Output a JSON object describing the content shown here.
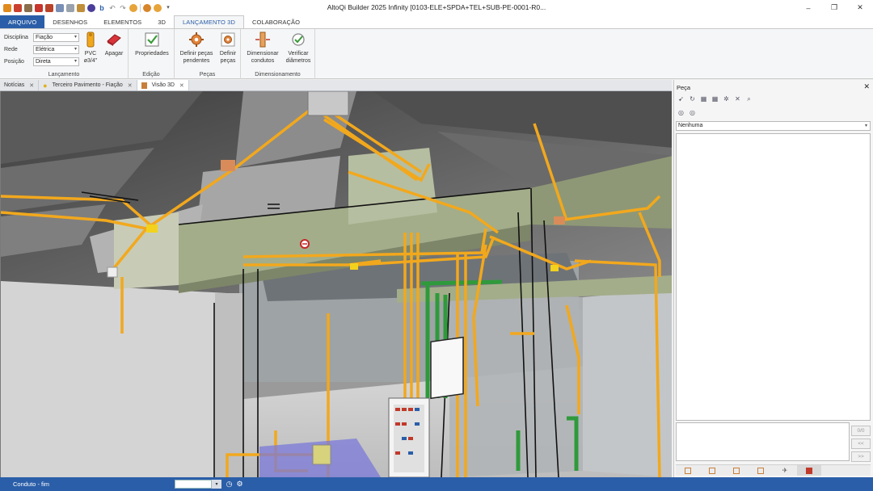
{
  "window": {
    "title": "AltoQi Builder 2025 Infinity [0103-ELE+SPDA+TEL+SUB-PE-0001-R0...",
    "controls": {
      "minimize": "–",
      "restore": "❐",
      "close": "✕"
    }
  },
  "ribbon_tabs": [
    {
      "label": "ARQUIVO"
    },
    {
      "label": "DESENHOS"
    },
    {
      "label": "ELEMENTOS"
    },
    {
      "label": "3D"
    },
    {
      "label": "LANÇAMENTO 3D"
    },
    {
      "label": "COLABORAÇÃO"
    }
  ],
  "ribbon": {
    "lancamento": {
      "group_label": "Lançamento",
      "disciplina_label": "Disciplina",
      "disciplina_value": "Fiação",
      "rede_label": "Rede",
      "rede_value": "Elétrica",
      "posicao_label": "Posição",
      "posicao_value": "Direta",
      "pvc_label_1": "PVC",
      "pvc_label_2": "ø3/4\"",
      "apagar_label": "Apagar"
    },
    "edicao": {
      "group_label": "Edição",
      "propriedades_label": "Propriedades"
    },
    "pecas": {
      "group_label": "Peças",
      "definir_pendentes_1": "Definir peças",
      "definir_pendentes_2": "pendentes",
      "definir_pecas_1": "Definir",
      "definir_pecas_2": "peças"
    },
    "dimensionamento": {
      "group_label": "Dimensionamento",
      "dimensionar_1": "Dimensionar",
      "dimensionar_2": "condutos",
      "verificar_1": "Verificar",
      "verificar_2": "diâmetros"
    }
  },
  "doc_tabs": [
    {
      "label": "Notícias",
      "close": "✕"
    },
    {
      "label": "Terceiro Pavimento - Fiação",
      "close": "✕"
    },
    {
      "label": "Visão 3D",
      "close": "✕"
    }
  ],
  "right_panel": {
    "title": "Peça",
    "close": "✕",
    "select_value": "Nenhuma",
    "counter": "0/0",
    "prev": "<<",
    "next": ">>"
  },
  "status": {
    "text": "Conduto - fim"
  },
  "colors": {
    "accent": "#2b5ea8",
    "conduit": "#f2a81d",
    "green_pipe": "#2f9a3c",
    "wall": "#a3ad8a"
  },
  "icons": {
    "qat": [
      "save-icon",
      "open-icon",
      "print-icon",
      "undo-icon",
      "redo-icon",
      "help-icon"
    ],
    "panel_tools": [
      "select-icon",
      "refresh-icon",
      "grid-icon",
      "grid-select-icon",
      "filter-icon",
      "zoom-icon"
    ]
  }
}
